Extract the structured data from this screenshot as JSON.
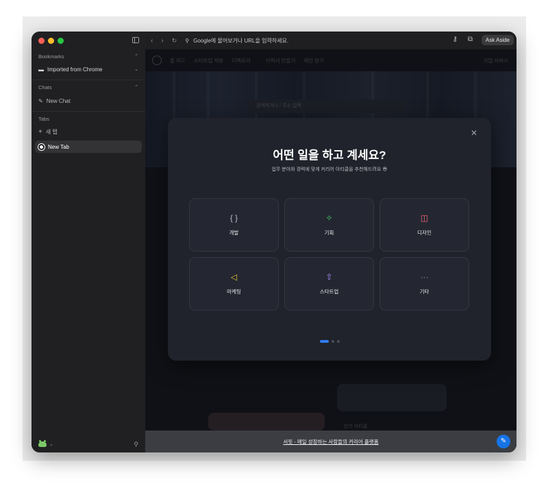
{
  "browser": {
    "address_placeholder": "Google에 물어보거나 URL을 입력하세요.",
    "ask_aside_label": "Ask Aside"
  },
  "sidebar": {
    "bookmarks_header": "Bookmarks",
    "bookmarks_items": [
      {
        "label": "Imported from Chrome"
      }
    ],
    "chats_header": "Chats",
    "chats_items": [
      {
        "label": "New Chat"
      }
    ],
    "tabs_header": "Tabs",
    "new_tab_action": "새 탭",
    "tabs_items": [
      {
        "label": "New Tab"
      }
    ]
  },
  "site": {
    "nav": [
      "홈 피드",
      "스타트업 채용",
      "디렉토리",
      "이력서 만들기",
      "제안 받기",
      "기업 서비스"
    ],
    "search_placeholder": "검색하거나 / 주소 입력",
    "footer_text": "서핏 - 매일 성장하는 사람들의 커리어 플랫폼",
    "popular_label": "인기 아티클"
  },
  "modal": {
    "title": "어떤 일을 하고 계세요?",
    "subtitle": "업무 분야와 경력에 맞게 커리어 아티클을 추천해드려요 😎",
    "options": [
      {
        "label": "개발",
        "icon": "code-braces-icon",
        "color": "#b8bac2"
      },
      {
        "label": "기획",
        "icon": "puzzle-icon",
        "color": "#3ecf6e"
      },
      {
        "label": "디자인",
        "icon": "palette-icon",
        "color": "#ff6b7a"
      },
      {
        "label": "마케팅",
        "icon": "megaphone-icon",
        "color": "#f4c430"
      },
      {
        "label": "스타트업",
        "icon": "rocket-icon",
        "color": "#a78bfa"
      },
      {
        "label": "기타",
        "icon": "more-dots-icon",
        "color": "#8a8c94"
      }
    ],
    "pages": 3,
    "active_page": 1
  },
  "colors": {
    "accent": "#2f7df0",
    "window_bg": "#1c1c1e",
    "modal_bg": "#20232b"
  }
}
